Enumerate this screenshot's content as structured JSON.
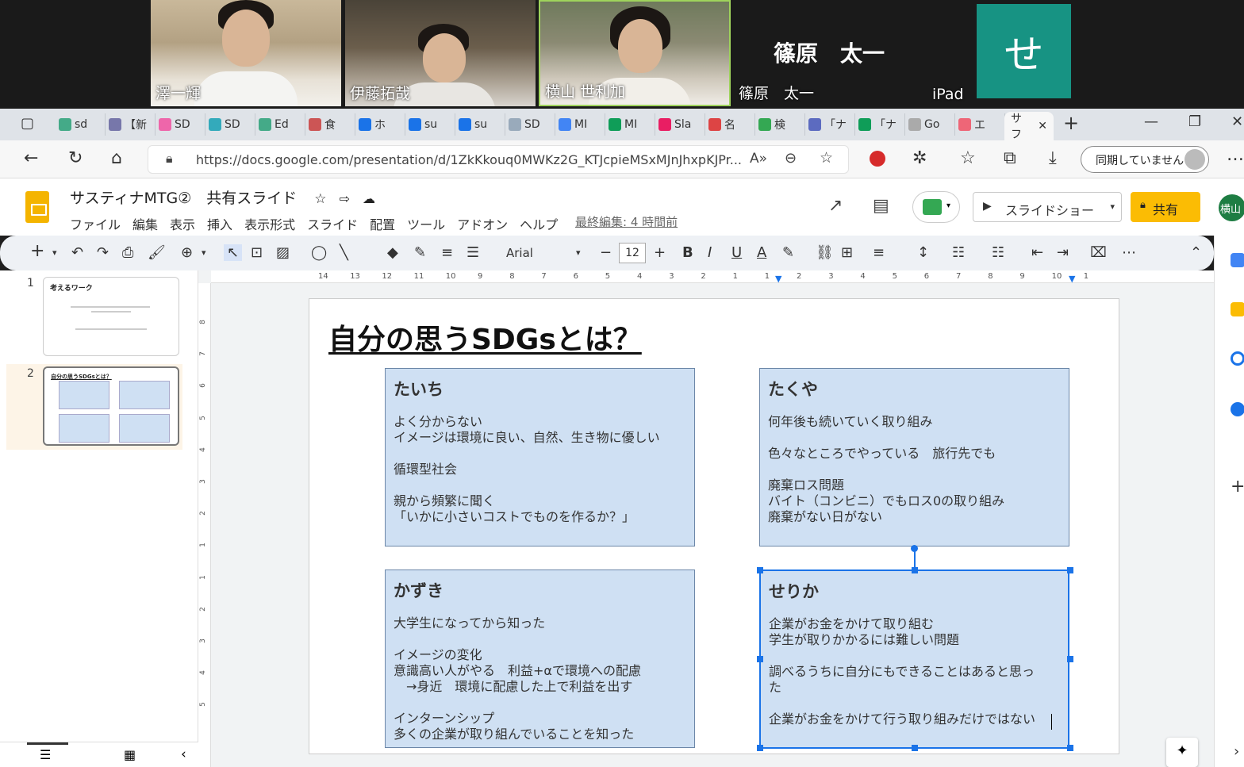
{
  "zoom": {
    "participants": [
      {
        "name": "澤一輝"
      },
      {
        "name": "伊藤拓哉"
      },
      {
        "name": "横山 世利加"
      },
      {
        "name": "篠原　太一",
        "big_name": "篠原　太一"
      },
      {
        "name": "iPad",
        "avatar_letter": "せ"
      }
    ]
  },
  "browser": {
    "tabs": [
      {
        "label": "sd"
      },
      {
        "label": "【新"
      },
      {
        "label": "SD"
      },
      {
        "label": "SD"
      },
      {
        "label": "Ed"
      },
      {
        "label": "食"
      },
      {
        "label": "ホ"
      },
      {
        "label": "su"
      },
      {
        "label": "su"
      },
      {
        "label": "SD"
      },
      {
        "label": "MI"
      },
      {
        "label": "MI"
      },
      {
        "label": "Sla"
      },
      {
        "label": "名"
      },
      {
        "label": "検"
      },
      {
        "label": "「ナ"
      },
      {
        "label": "「ナ"
      },
      {
        "label": "Go"
      },
      {
        "label": "エ"
      },
      {
        "label": "サフ"
      }
    ],
    "url": "https://docs.google.com/presentation/d/1ZkKkouq0MWKz2G_KTJcpieMSxMJnJhxpKJPr...",
    "sync_label": "同期していません"
  },
  "slides_app": {
    "doc_title": "サスティナMTG②　共有スライド",
    "menu": [
      "ファイル",
      "編集",
      "表示",
      "挿入",
      "表示形式",
      "スライド",
      "配置",
      "ツール",
      "アドオン",
      "ヘルプ"
    ],
    "last_edit": "最終編集: 4 時間前",
    "slideshow_label": "スライドショー",
    "share_label": "共有",
    "user_initial": "横山",
    "font_name": "Arial",
    "font_size": "12"
  },
  "filmstrip": [
    {
      "num": "1",
      "title": "考えるワーク"
    },
    {
      "num": "2",
      "title": "自分の思うSDGsとは？"
    }
  ],
  "ruler": {
    "top": [
      "14",
      "13",
      "12",
      "11",
      "10",
      "9",
      "8",
      "7",
      "6",
      "5",
      "4",
      "3",
      "2",
      "1",
      "1",
      "2",
      "3",
      "4",
      "5",
      "6",
      "7",
      "8",
      "9",
      "10",
      "1"
    ],
    "left": [
      "8",
      "7",
      "6",
      "5",
      "4",
      "3",
      "2",
      "1",
      "1",
      "2",
      "3",
      "4",
      "5"
    ]
  },
  "slide": {
    "title": "自分の思うSDGsとは？",
    "cards": [
      {
        "name": "たいち",
        "body": "よく分からない\nイメージは環境に良い、自然、生き物に優しい\n\n循環型社会\n\n親から頻繁に聞く\n「いかに小さいコストでものを作るか？」"
      },
      {
        "name": "たくや",
        "body": "何年後も続いていく取り組み\n\n色々なところでやっている　旅行先でも\n\n廃棄ロス問題\nバイト（コンビニ）でもロス0の取り組み\n廃棄がない日がない"
      },
      {
        "name": "かずき",
        "body": "大学生になってから知った\n\nイメージの変化\n意識高い人がやる　利益+αで環境への配慮\n　→身近　環境に配慮した上で利益を出す\n\nインターンシップ\n多くの企業が取り組んでいることを知った"
      },
      {
        "name": "せりか",
        "body": "企業がお金をかけて取り組む\n学生が取りかかるには難しい問題\n\n調べるうちに自分にもできることはあると思っ\nた\n\n企業がお金をかけて行う取り組みだけではない"
      }
    ]
  }
}
